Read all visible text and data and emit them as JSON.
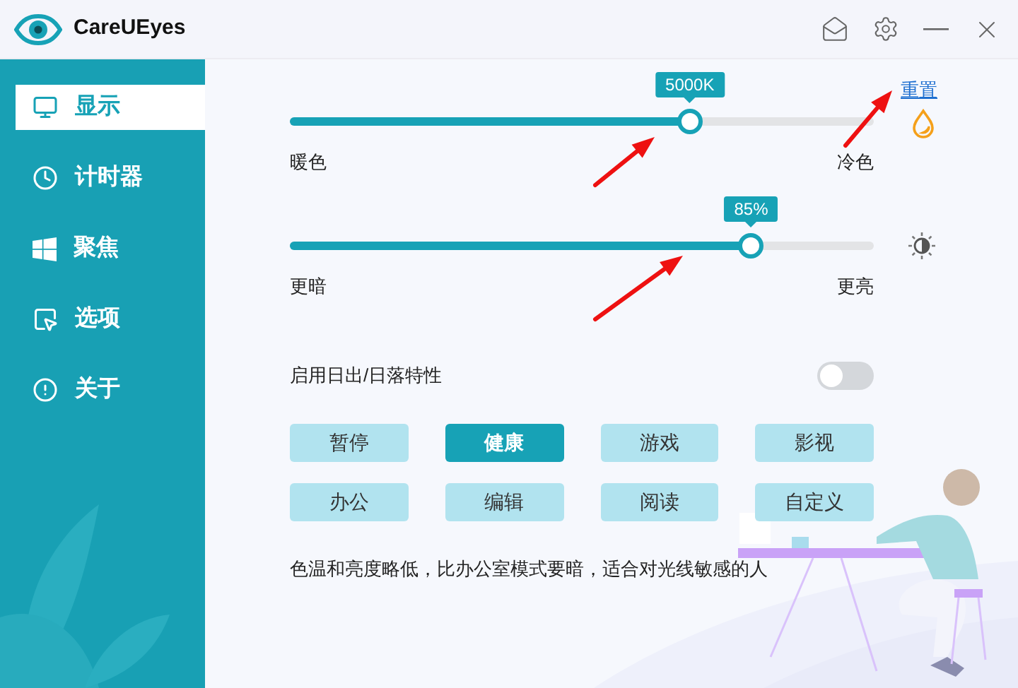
{
  "window": {
    "title": "CareUEyes"
  },
  "sidebar": {
    "items": [
      {
        "label": "显示",
        "kind": "monitor",
        "selected": true
      },
      {
        "label": "计时器",
        "kind": "clock",
        "selected": false
      },
      {
        "label": "聚焦",
        "kind": "windows",
        "selected": false
      },
      {
        "label": "选项",
        "kind": "cursor",
        "selected": false
      },
      {
        "label": "关于",
        "kind": "info",
        "selected": false
      }
    ]
  },
  "sliders": [
    {
      "kind": "temperature",
      "bubble": "5000K",
      "level": 0.685,
      "low_label": "暖色",
      "high_label": "冷色"
    },
    {
      "kind": "brightness",
      "bubble": "85%",
      "level": 0.79,
      "low_label": "更暗",
      "high_label": "更亮"
    }
  ],
  "reset_link": "重置",
  "sunrise_toggle": {
    "label": "启用日出/日落特性",
    "on": false
  },
  "modes": [
    {
      "label": "暂停",
      "selected": false
    },
    {
      "label": "健康",
      "selected": true
    },
    {
      "label": "游戏",
      "selected": false
    },
    {
      "label": "影视",
      "selected": false
    },
    {
      "label": "办公",
      "selected": false
    },
    {
      "label": "编辑",
      "selected": false
    },
    {
      "label": "阅读",
      "selected": false
    },
    {
      "label": "自定义",
      "selected": false
    }
  ],
  "description": "色温和亮度略低，比办公室模式要暗，适合对光线敏感的人"
}
